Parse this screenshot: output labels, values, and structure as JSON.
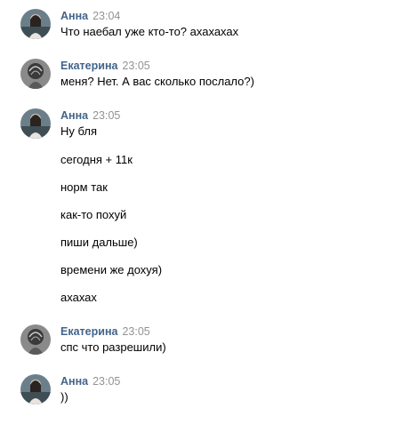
{
  "messages": [
    {
      "author": "Анна",
      "time": "23:04",
      "avatar": "avatar-anna",
      "lines": [
        "Что наебал уже кто-то? ахахахах"
      ]
    },
    {
      "author": "Екатерина",
      "time": "23:05",
      "avatar": "avatar-ekaterina",
      "lines": [
        "меня? Нет. А вас сколько послало?)"
      ]
    },
    {
      "author": "Анна",
      "time": "23:05",
      "avatar": "avatar-anna",
      "lines": [
        "Ну бля",
        "сегодня + 11к",
        "норм так",
        "как-то похуй",
        "пиши дальше)",
        "времени же дохуя)",
        "ахахах"
      ]
    },
    {
      "author": "Екатерина",
      "time": "23:05",
      "avatar": "avatar-ekaterina",
      "lines": [
        "спс что разрешили)"
      ]
    },
    {
      "author": "Анна",
      "time": "23:05",
      "avatar": "avatar-anna",
      "lines": [
        "))"
      ]
    }
  ],
  "colors": {
    "author": "#42648b",
    "time": "#939393",
    "text": "#000000",
    "background": "#ffffff"
  }
}
